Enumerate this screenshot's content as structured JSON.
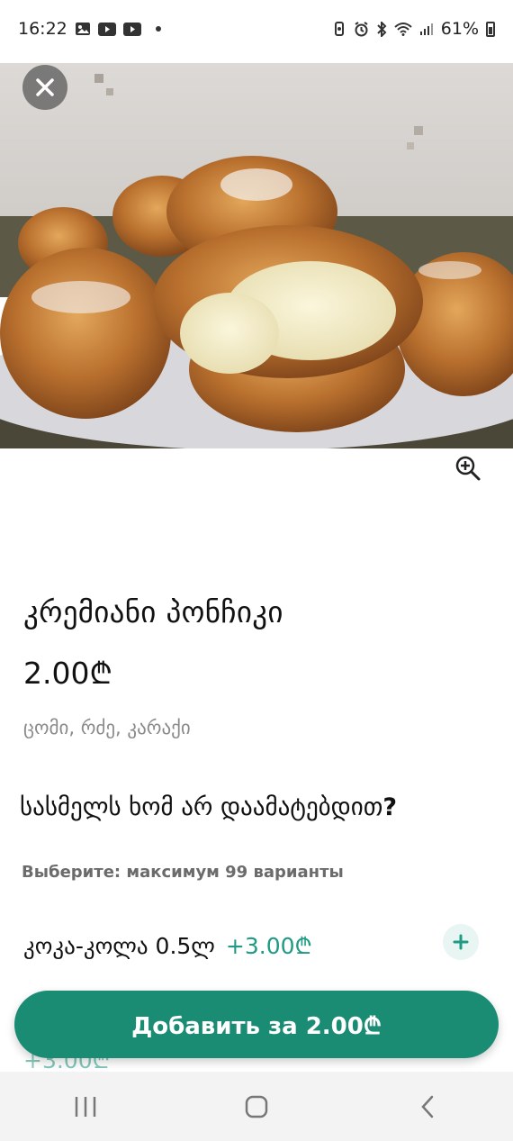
{
  "status_bar": {
    "time": "16:22",
    "battery_percent": "61%",
    "left_icons": [
      "gallery-icon",
      "youtube-icon",
      "youtube-icon",
      "dot-icon"
    ],
    "right_icons": [
      "vibrate-icon",
      "alarm-icon",
      "bluetooth-icon",
      "wifi-icon",
      "signal-icon",
      "battery-icon"
    ]
  },
  "hero": {
    "close_icon": "close-icon",
    "zoom_icon": "zoom-in-icon"
  },
  "product": {
    "title": "კრემიანი პონჩიკი",
    "price": "2.00₾",
    "ingredients": "ცომი, რძე, კარაქი"
  },
  "addon_section": {
    "question_text": "სასმელს ხომ არ დაამატებდით",
    "question_mark": "?",
    "hint": "Выберите: максимум 99 варианты",
    "options": [
      {
        "name": "კოკა-კოლა 0.5ლ",
        "price": "+3.00₾",
        "icon": "plus-icon"
      }
    ],
    "peek_price": "+3.00₾"
  },
  "cta": {
    "label": "Добавить за 2.00₾"
  },
  "nav": {
    "items": [
      "recent-apps-icon",
      "home-icon",
      "back-icon"
    ]
  },
  "colors": {
    "accent": "#1a8c74",
    "accent_text": "#1f9a83",
    "muted": "#8a8a8a"
  }
}
